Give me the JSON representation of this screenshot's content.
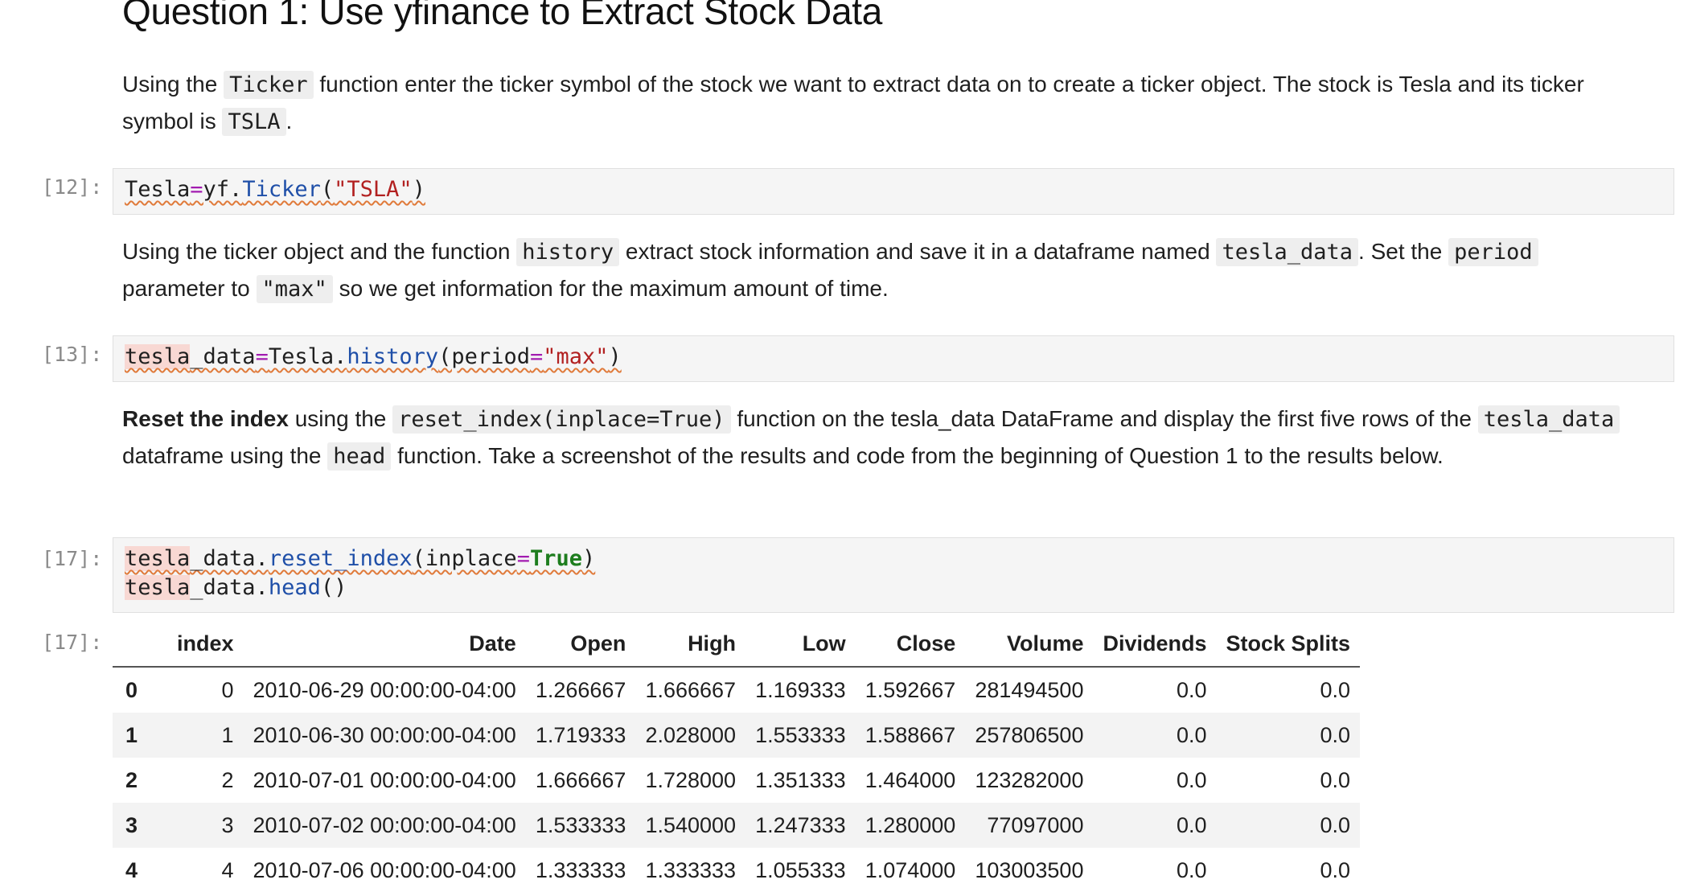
{
  "heading": "Question 1: Use yfinance to Extract Stock Data",
  "md1": {
    "t1": "Using the ",
    "c1": "Ticker",
    "t2": " function enter the ticker symbol of the stock we want to extract data on to create a ticker object. The stock is Tesla and its ticker symbol is ",
    "c2": "TSLA",
    "t3": "."
  },
  "cell12": {
    "prompt": "[12]:",
    "code": [
      {
        "text": "Tesla",
        "cls": ""
      },
      {
        "text": "=",
        "cls": "op"
      },
      {
        "text": "yf.",
        "cls": ""
      },
      {
        "text": "Ticker",
        "cls": "fn"
      },
      {
        "text": "(",
        "cls": ""
      },
      {
        "text": "\"TSLA\"",
        "cls": "st"
      },
      {
        "text": ")",
        "cls": ""
      }
    ]
  },
  "md2": {
    "t1": "Using the ticker object and the function ",
    "c1": "history",
    "t2": " extract stock information and save it in a dataframe named ",
    "c2": "tesla_data",
    "t3": ". Set the ",
    "c3": "period",
    "t4": " parameter to ",
    "c4": "\"max\"",
    "t5": " so we get information for the maximum amount of time."
  },
  "cell13": {
    "prompt": "[13]:",
    "code": [
      {
        "text": "tesla",
        "cls": "hl"
      },
      {
        "text": "_data",
        "cls": ""
      },
      {
        "text": "=",
        "cls": "op"
      },
      {
        "text": "Tesla.",
        "cls": ""
      },
      {
        "text": "history",
        "cls": "fn"
      },
      {
        "text": "(period",
        "cls": ""
      },
      {
        "text": "=",
        "cls": "op"
      },
      {
        "text": "\"max\"",
        "cls": "st"
      },
      {
        "text": ")",
        "cls": ""
      }
    ]
  },
  "md3": {
    "b1": "Reset the index",
    "t1": " using the ",
    "c1": "reset_index(inplace=True)",
    "t2": " function on the tesla_data DataFrame and display the first five rows of the ",
    "c2": "tesla_data",
    "t3": " dataframe using the ",
    "c3": "head",
    "t4": " function. Take a screenshot of the results and code from the beginning of Question 1 to the results below."
  },
  "cell17": {
    "prompt": "[17]:",
    "out_prompt": "[17]:",
    "line1": [
      {
        "text": "tesla",
        "cls": "hl"
      },
      {
        "text": "_data.",
        "cls": ""
      },
      {
        "text": "reset_index",
        "cls": "fn"
      },
      {
        "text": "(inplace",
        "cls": ""
      },
      {
        "text": "=",
        "cls": "op"
      },
      {
        "text": "True",
        "cls": "kw"
      },
      {
        "text": ")",
        "cls": ""
      }
    ],
    "line2": [
      {
        "text": "tesla",
        "cls": "hl"
      },
      {
        "text": "_data.",
        "cls": ""
      },
      {
        "text": "head",
        "cls": "fn"
      },
      {
        "text": "()",
        "cls": ""
      }
    ]
  },
  "table": {
    "columns": [
      "",
      "index",
      "Date",
      "Open",
      "High",
      "Low",
      "Close",
      "Volume",
      "Dividends",
      "Stock Splits"
    ],
    "rows": [
      [
        "0",
        "0",
        "2010-06-29 00:00:00-04:00",
        "1.266667",
        "1.666667",
        "1.169333",
        "1.592667",
        "281494500",
        "0.0",
        "0.0"
      ],
      [
        "1",
        "1",
        "2010-06-30 00:00:00-04:00",
        "1.719333",
        "2.028000",
        "1.553333",
        "1.588667",
        "257806500",
        "0.0",
        "0.0"
      ],
      [
        "2",
        "2",
        "2010-07-01 00:00:00-04:00",
        "1.666667",
        "1.728000",
        "1.351333",
        "1.464000",
        "123282000",
        "0.0",
        "0.0"
      ],
      [
        "3",
        "3",
        "2010-07-02 00:00:00-04:00",
        "1.533333",
        "1.540000",
        "1.247333",
        "1.280000",
        "77097000",
        "0.0",
        "0.0"
      ],
      [
        "4",
        "4",
        "2010-07-06 00:00:00-04:00",
        "1.333333",
        "1.333333",
        "1.055333",
        "1.074000",
        "103003500",
        "0.0",
        "0.0"
      ]
    ]
  }
}
